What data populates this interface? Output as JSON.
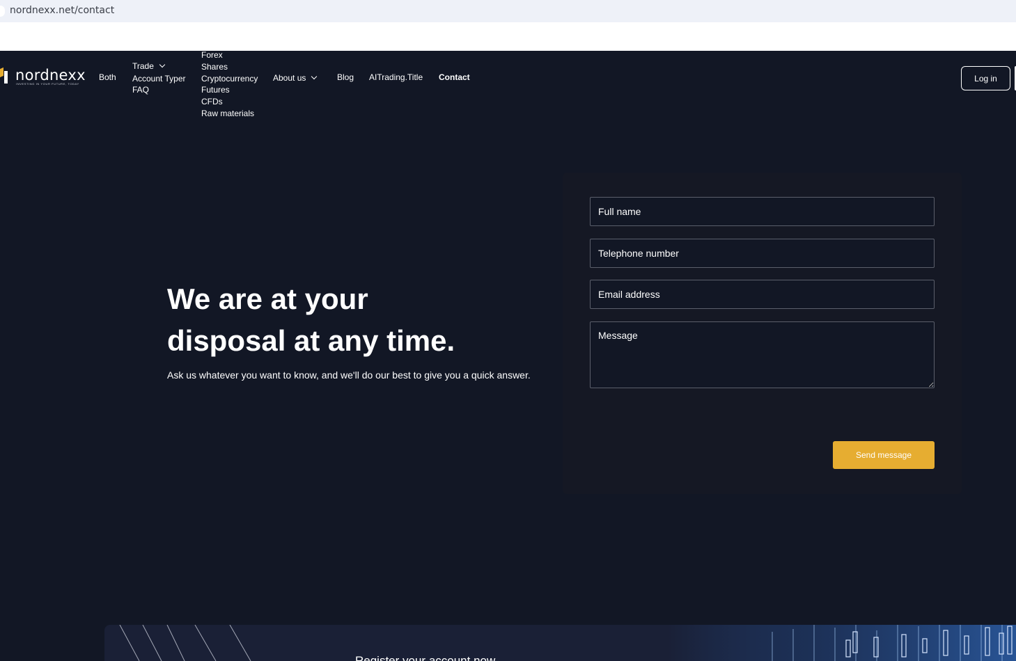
{
  "browser": {
    "url": "nordnexx.net/contact"
  },
  "brand": {
    "name": "nordnexx",
    "tagline": "INVESTING IN YOUR FUTURE, TODAY",
    "accent_color": "#e6ad31",
    "background_color": "#121725"
  },
  "nav": {
    "both": "Both",
    "trade": "Trade",
    "account_typer": "Account Typer",
    "faq": "FAQ",
    "trade_items": [
      "Forex",
      "Shares",
      "Cryptocurrency",
      "Futures",
      "CFDs",
      "Raw materials"
    ],
    "about_us": "About us",
    "blog": "Blog",
    "aitrading": "AITrading.Title",
    "contact": "Contact",
    "login": "Log in"
  },
  "hero": {
    "title_line1": "We are at your",
    "title_line2": "disposal at any time.",
    "subtitle": "Ask us whatever you want to know, and we'll do our best to give you a quick answer."
  },
  "form": {
    "full_name_placeholder": "Full name",
    "phone_placeholder": "Telephone number",
    "email_placeholder": "Email address",
    "message_placeholder": "Message",
    "send_label": "Send message"
  },
  "banner": {
    "text": "Register your account now"
  }
}
